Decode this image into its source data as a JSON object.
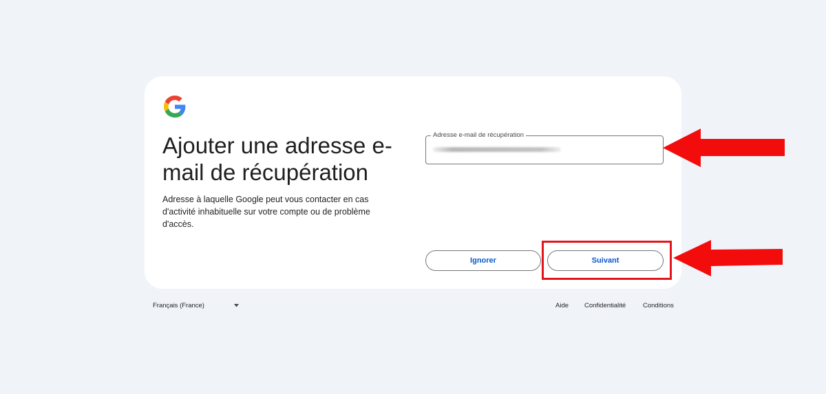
{
  "card": {
    "title": "Ajouter une adresse e-mail de récupération",
    "description": "Adresse à laquelle Google peut vous contacter en cas d'activité inhabituelle sur votre compte ou de problème d'accès."
  },
  "recovery_field": {
    "label": "Adresse e-mail de récupération",
    "value": ""
  },
  "buttons": {
    "skip_label": "Ignorer",
    "next_label": "Suivant"
  },
  "footer": {
    "language": "Français (France)",
    "help": "Aide",
    "privacy": "Confidentialité",
    "terms": "Conditions"
  },
  "colors": {
    "background": "#f0f4f9",
    "accent": "#0b57d0",
    "annotation": "#e3141a"
  },
  "icons": {
    "logo": "google-g-logo",
    "language_dropdown": "caret-down-icon",
    "annotation": "red-arrow-icon"
  }
}
